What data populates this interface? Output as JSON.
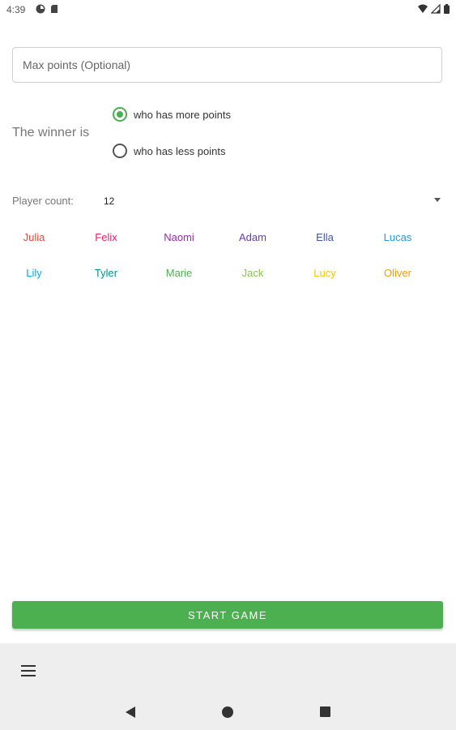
{
  "status_bar": {
    "time": "4:39",
    "left_icons": [
      "data-saver-icon",
      "sd-card-icon"
    ],
    "right_icons": [
      "wifi-icon",
      "signal-icon",
      "battery-icon"
    ]
  },
  "form": {
    "max_points_placeholder": "Max points (Optional)",
    "max_points_value": "",
    "winner_label": "The winner is",
    "options": [
      {
        "label": "who has more points",
        "selected": true
      },
      {
        "label": "who has less points",
        "selected": false
      }
    ],
    "player_count_label": "Player count:",
    "player_count_value": "12"
  },
  "players": [
    {
      "name": "Julia",
      "color": "#f44336"
    },
    {
      "name": "Felix",
      "color": "#e91e63"
    },
    {
      "name": "Naomi",
      "color": "#9c27b0"
    },
    {
      "name": "Adam",
      "color": "#673ab7"
    },
    {
      "name": "Ella",
      "color": "#3f51b5"
    },
    {
      "name": "Lucas",
      "color": "#2196f3"
    },
    {
      "name": "Lily",
      "color": "#03a9f4"
    },
    {
      "name": "Tyler",
      "color": "#009688"
    },
    {
      "name": "Marie",
      "color": "#4caf50"
    },
    {
      "name": "Jack",
      "color": "#8bc34a"
    },
    {
      "name": "Lucy",
      "color": "#ffc107"
    },
    {
      "name": "Oliver",
      "color": "#ff9800"
    }
  ],
  "start_button": {
    "label": "START GAME",
    "color": "#4caf50"
  },
  "nav_bar": {
    "menu_icon": "hamburger-menu-icon",
    "back_icon": "back-triangle-icon",
    "home_icon": "home-circle-icon",
    "recents_icon": "recents-square-icon"
  }
}
